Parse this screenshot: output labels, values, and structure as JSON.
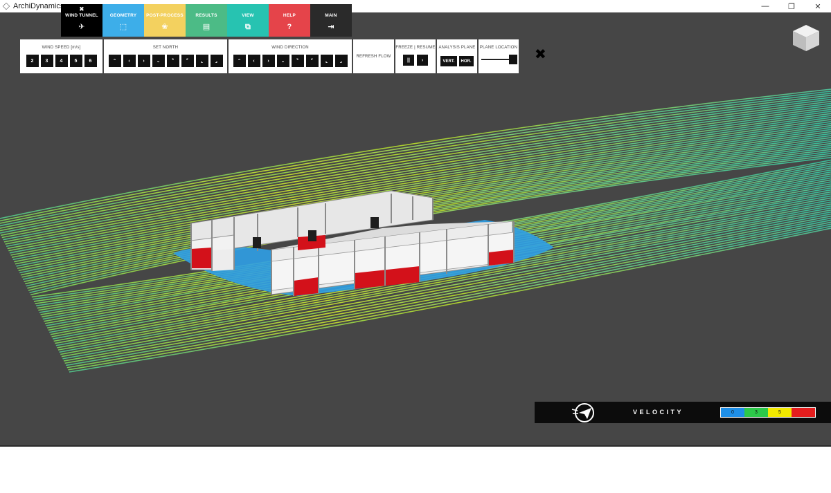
{
  "window": {
    "title": "ArchiDynamics",
    "controls": {
      "minimize": "—",
      "restore": "❐",
      "close": "✕"
    }
  },
  "nav": {
    "tabs": [
      {
        "id": "wind-tunnel",
        "label": "WIND TUNNEL",
        "icon": "paper-plane-icon",
        "color": "#000000",
        "text_color": "#ffffff",
        "active": true,
        "close": "✖",
        "glyph": "✈"
      },
      {
        "id": "geometry",
        "label": "GEOMETRY",
        "icon": "cube-outline-icon",
        "color": "#3daee9",
        "text_color": "#ffffff",
        "glyph": "⬚"
      },
      {
        "id": "post-process",
        "label": "POST-PROCESS",
        "icon": "swirl-icon",
        "color": "#f3d15f",
        "text_color": "#ffffff",
        "glyph": "❀"
      },
      {
        "id": "results",
        "label": "RESULTS",
        "icon": "clipboard-icon",
        "color": "#4cbb86",
        "text_color": "#ffffff",
        "glyph": "📋"
      },
      {
        "id": "view",
        "label": "VIEW",
        "icon": "view-cube-icon",
        "color": "#27c3b1",
        "text_color": "#ffffff",
        "glyph": "⧉"
      },
      {
        "id": "help",
        "label": "HELP",
        "icon": "question-icon",
        "color": "#e5444a",
        "text_color": "#ffffff",
        "glyph": "?"
      },
      {
        "id": "main",
        "label": "MAIN",
        "icon": "exit-icon",
        "color": "#2a2a2a",
        "text_color": "#ffffff",
        "glyph": "⇥"
      }
    ]
  },
  "panels": {
    "wind_speed": {
      "title": "WIND SPEED [m/s]",
      "options": [
        "2",
        "3",
        "4",
        "5",
        "6"
      ]
    },
    "set_north": {
      "title": "SET NORTH",
      "buttons": [
        "⌃",
        "‹",
        "›",
        "⌄",
        "⌝",
        "⌜",
        "⌞",
        "⌟"
      ]
    },
    "wind_direction": {
      "title": "WIND DIRECTION",
      "buttons": [
        "⌃",
        "‹",
        "›",
        "⌄",
        "⌝",
        "⌜",
        "⌞",
        "⌟"
      ]
    },
    "refresh": {
      "label": "REFRESH FLOW"
    },
    "freeze": {
      "title": "FREEZE | RESUME",
      "pause": "||",
      "play": "›"
    },
    "analysis_plane": {
      "title": "ANALYSIS PLANE",
      "vert": "VERT.",
      "hor": "HOR."
    },
    "plane_location": {
      "title": "PLANE LOCATION",
      "value": 1.0
    },
    "close_symbol": "✖"
  },
  "legend": {
    "title": "VELOCITY",
    "segments": [
      {
        "label": "0",
        "color": "#1e8fe8"
      },
      {
        "label": "3",
        "color": "#2cc84a"
      },
      {
        "label": "5",
        "color": "#f2ea00"
      },
      {
        "label": "",
        "color": "#e41d1d"
      }
    ]
  },
  "colors": {
    "viewport_bg": "#464646",
    "stream_low": "#3aa7e8",
    "stream_mid": "#5fd08a",
    "stream_high": "#d8e61a",
    "partition_red": "#d3111a"
  }
}
